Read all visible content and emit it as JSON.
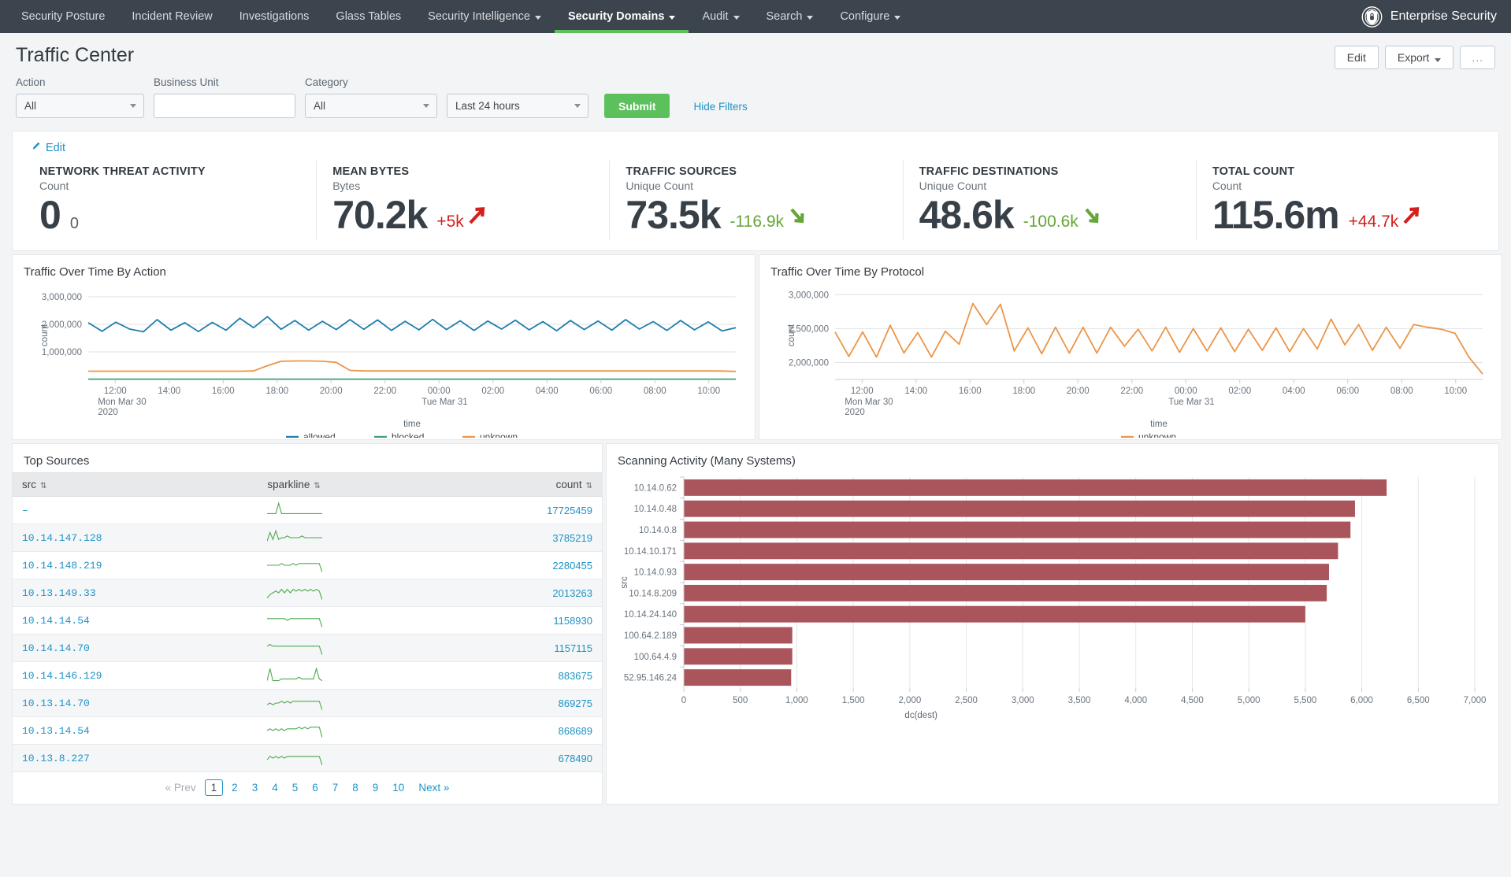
{
  "nav": {
    "items": [
      {
        "label": "Security Posture",
        "dropdown": false,
        "active": false
      },
      {
        "label": "Incident Review",
        "dropdown": false,
        "active": false
      },
      {
        "label": "Investigations",
        "dropdown": false,
        "active": false
      },
      {
        "label": "Glass Tables",
        "dropdown": false,
        "active": false
      },
      {
        "label": "Security Intelligence",
        "dropdown": true,
        "active": false
      },
      {
        "label": "Security Domains",
        "dropdown": true,
        "active": true
      },
      {
        "label": "Audit",
        "dropdown": true,
        "active": false
      },
      {
        "label": "Search",
        "dropdown": true,
        "active": false
      },
      {
        "label": "Configure",
        "dropdown": true,
        "active": false
      }
    ],
    "brand": "Enterprise Security",
    "brand_icon": "shield-lock-icon"
  },
  "header": {
    "title": "Traffic Center",
    "edit_label": "Edit",
    "export_label": "Export",
    "more_label": "..."
  },
  "filters": {
    "action": {
      "label": "Action",
      "value": "All"
    },
    "business_unit": {
      "label": "Business Unit",
      "value": "",
      "placeholder": ""
    },
    "category": {
      "label": "Category",
      "value": "All"
    },
    "time": {
      "value": "Last 24 hours"
    },
    "submit_label": "Submit",
    "hide_filters_label": "Hide Filters"
  },
  "kpi": {
    "edit_label": "Edit",
    "items": [
      {
        "name": "NETWORK THREAT ACTIVITY",
        "sub": "Count",
        "value": "0",
        "delta": "0",
        "direction": "zero"
      },
      {
        "name": "MEAN BYTES",
        "sub": "Bytes",
        "value": "70.2k",
        "delta": "+5k",
        "direction": "up"
      },
      {
        "name": "TRAFFIC SOURCES",
        "sub": "Unique Count",
        "value": "73.5k",
        "delta": "-116.9k",
        "direction": "down"
      },
      {
        "name": "TRAFFIC DESTINATIONS",
        "sub": "Unique Count",
        "value": "48.6k",
        "delta": "-100.6k",
        "direction": "down"
      },
      {
        "name": "TOTAL COUNT",
        "sub": "Count",
        "value": "115.6m",
        "delta": "+44.7k",
        "direction": "up"
      }
    ],
    "colors": {
      "up": "#d41f1f",
      "down": "#65a637",
      "value": "#373f47"
    }
  },
  "chart_data": [
    {
      "id": "traffic-by-action",
      "type": "line",
      "title": "Traffic Over Time By Action",
      "xlabel": "time",
      "ylabel": "count",
      "ylim": [
        0,
        3200000
      ],
      "yticks": [
        1000000,
        2000000,
        3000000
      ],
      "ytick_labels": [
        "1,000,000",
        "2,000,000",
        "3,000,000"
      ],
      "grid": true,
      "legend_position": "bottom",
      "xtick_labels": [
        "12:00",
        "14:00",
        "16:00",
        "18:00",
        "20:00",
        "22:00",
        "00:00",
        "02:00",
        "04:00",
        "06:00",
        "08:00",
        "10:00"
      ],
      "x_day_labels": [
        {
          "at": "12:00",
          "lines": [
            "Mon Mar 30",
            "2020"
          ]
        },
        {
          "at": "00:00",
          "lines": [
            "Tue Mar 31"
          ]
        }
      ],
      "series": [
        {
          "name": "allowed",
          "color": "#1e7eab",
          "values": [
            2060000,
            1750000,
            2080000,
            1830000,
            1730000,
            2170000,
            1790000,
            2060000,
            1740000,
            2070000,
            1790000,
            2220000,
            1880000,
            2280000,
            1820000,
            2140000,
            1790000,
            2110000,
            1810000,
            2170000,
            1820000,
            2160000,
            1780000,
            2110000,
            1800000,
            2180000,
            1810000,
            2130000,
            1780000,
            2120000,
            1830000,
            2150000,
            1800000,
            2100000,
            1770000,
            2140000,
            1810000,
            2120000,
            1790000,
            2170000,
            1830000,
            2100000,
            1780000,
            2140000,
            1800000,
            2090000,
            1760000,
            1880000
          ]
        },
        {
          "name": "blocked",
          "color": "#3f9f73",
          "values": [
            12000,
            12000,
            12000,
            12000,
            12000,
            12000,
            12000,
            12000,
            12000,
            12000,
            12000,
            12000,
            12000,
            12000,
            12000,
            12000,
            12000,
            12000,
            12000,
            12000,
            12000,
            12000,
            12000,
            12000,
            12000,
            12000,
            12000,
            12000,
            12000,
            12000,
            12000,
            12000,
            12000,
            12000,
            12000,
            12000,
            12000,
            12000,
            12000,
            12000,
            12000,
            12000,
            12000,
            12000,
            12000,
            12000,
            12000,
            12000
          ]
        },
        {
          "name": "unknown",
          "color": "#ec9547",
          "values": [
            300000,
            300000,
            300000,
            300000,
            300000,
            300000,
            300000,
            300000,
            300000,
            300000,
            300000,
            300000,
            310000,
            500000,
            660000,
            670000,
            670000,
            660000,
            620000,
            330000,
            310000,
            310000,
            310000,
            310000,
            310000,
            310000,
            310000,
            310000,
            310000,
            310000,
            310000,
            310000,
            310000,
            310000,
            310000,
            310000,
            310000,
            310000,
            310000,
            310000,
            310000,
            310000,
            310000,
            310000,
            310000,
            310000,
            305000,
            290000
          ]
        }
      ]
    },
    {
      "id": "traffic-by-protocol",
      "type": "line",
      "title": "Traffic Over Time By Protocol",
      "xlabel": "time",
      "ylabel": "count",
      "ylim": [
        1750000,
        3050000
      ],
      "yticks": [
        2000000,
        2500000,
        3000000
      ],
      "ytick_labels": [
        "2,000,000",
        "2,500,000",
        "3,000,000"
      ],
      "grid": true,
      "legend_position": "bottom",
      "xtick_labels": [
        "12:00",
        "14:00",
        "16:00",
        "18:00",
        "20:00",
        "22:00",
        "00:00",
        "02:00",
        "04:00",
        "06:00",
        "08:00",
        "10:00"
      ],
      "x_day_labels": [
        {
          "at": "12:00",
          "lines": [
            "Mon Mar 30",
            "2020"
          ]
        },
        {
          "at": "00:00",
          "lines": [
            "Tue Mar 31"
          ]
        }
      ],
      "series": [
        {
          "name": "unknown",
          "color": "#ec9547",
          "values": [
            2450000,
            2090000,
            2450000,
            2080000,
            2550000,
            2140000,
            2440000,
            2080000,
            2460000,
            2270000,
            2870000,
            2560000,
            2860000,
            2170000,
            2510000,
            2130000,
            2520000,
            2140000,
            2520000,
            2140000,
            2520000,
            2240000,
            2490000,
            2170000,
            2520000,
            2150000,
            2500000,
            2170000,
            2510000,
            2160000,
            2490000,
            2180000,
            2510000,
            2160000,
            2500000,
            2200000,
            2640000,
            2260000,
            2560000,
            2180000,
            2520000,
            2210000,
            2560000,
            2520000,
            2490000,
            2430000,
            2080000,
            1830000
          ]
        }
      ]
    },
    {
      "id": "scanning-activity",
      "type": "bar",
      "orientation": "horizontal",
      "title": "Scanning Activity (Many Systems)",
      "xlabel": "dc(dest)",
      "ylabel": "src",
      "xlim": [
        0,
        7000
      ],
      "xticks": [
        0,
        500,
        1000,
        1500,
        2000,
        2500,
        3000,
        3500,
        4000,
        4500,
        5000,
        5500,
        6000,
        6500,
        7000
      ],
      "xtick_labels": [
        "0",
        "500",
        "1,000",
        "1,500",
        "2,000",
        "2,500",
        "3,000",
        "3,500",
        "4,000",
        "4,500",
        "5,000",
        "5,500",
        "6,000",
        "6,500",
        "7,000"
      ],
      "bar_color": "#a9555b",
      "categories": [
        "10.14.0.62",
        "10.14.0.48",
        "10.14.0.8",
        "10.14.10.171",
        "10.14.0.93",
        "10.14.8.209",
        "10.14.24.140",
        "100.64.2.189",
        "100.64.4.9",
        "52.95.146.24"
      ],
      "values": [
        6220,
        5940,
        5900,
        5790,
        5710,
        5690,
        5500,
        960,
        960,
        950
      ]
    }
  ],
  "top_sources": {
    "title": "Top Sources",
    "columns": [
      {
        "label": "src",
        "align": "left"
      },
      {
        "label": "sparkline",
        "align": "left"
      },
      {
        "label": "count",
        "align": "right"
      }
    ],
    "rows": [
      {
        "src": "–",
        "count": "17725459",
        "spark": [
          3,
          3,
          3,
          3,
          9,
          3,
          3,
          3,
          3,
          3,
          3,
          3,
          3,
          3,
          3,
          3,
          3,
          3,
          3,
          3
        ]
      },
      {
        "src": "10.14.147.128",
        "count": "3785219",
        "spark": [
          3,
          8,
          4,
          9,
          4,
          5,
          5,
          6,
          5,
          5,
          5,
          5,
          6,
          5,
          5,
          5,
          5,
          5,
          5,
          5
        ]
      },
      {
        "src": "10.14.148.219",
        "count": "2280455",
        "spark": [
          5,
          5,
          5,
          5,
          5,
          6,
          5,
          5,
          5,
          6,
          5,
          6,
          6,
          6,
          6,
          6,
          6,
          6,
          6,
          1
        ]
      },
      {
        "src": "10.13.149.33",
        "count": "2013263",
        "spark": [
          2,
          4,
          5,
          6,
          5,
          7,
          5,
          7,
          5,
          7,
          6,
          7,
          6,
          7,
          6,
          7,
          6,
          7,
          6,
          1
        ]
      },
      {
        "src": "10.14.14.54",
        "count": "1158930",
        "spark": [
          6,
          6,
          6,
          6,
          6,
          6,
          6,
          5,
          6,
          6,
          6,
          6,
          6,
          6,
          6,
          6,
          6,
          6,
          6,
          1
        ]
      },
      {
        "src": "10.14.14.70",
        "count": "1157115",
        "spark": [
          6,
          7,
          6,
          6,
          6,
          6,
          6,
          6,
          6,
          6,
          6,
          6,
          6,
          6,
          6,
          6,
          6,
          6,
          6,
          1
        ]
      },
      {
        "src": "10.14.146.129",
        "count": "883675",
        "spark": [
          2,
          9,
          2,
          2,
          2,
          3,
          3,
          3,
          3,
          3,
          3,
          4,
          3,
          3,
          3,
          3,
          3,
          9,
          3,
          2
        ]
      },
      {
        "src": "10.13.14.70",
        "count": "869275",
        "spark": [
          4,
          5,
          4,
          5,
          5,
          6,
          5,
          6,
          5,
          6,
          6,
          6,
          6,
          6,
          6,
          6,
          6,
          6,
          6,
          1
        ]
      },
      {
        "src": "10.13.14.54",
        "count": "868689",
        "spark": [
          5,
          6,
          5,
          6,
          5,
          6,
          5,
          6,
          6,
          6,
          6,
          7,
          6,
          7,
          6,
          7,
          7,
          7,
          7,
          1
        ]
      },
      {
        "src": "10.13.8.227",
        "count": "678490",
        "spark": [
          4,
          6,
          5,
          6,
          5,
          6,
          5,
          6,
          6,
          6,
          6,
          6,
          6,
          6,
          6,
          6,
          6,
          6,
          6,
          1
        ]
      }
    ],
    "pager": {
      "prev": "« Prev",
      "pages": [
        "1",
        "2",
        "3",
        "4",
        "5",
        "6",
        "7",
        "8",
        "9",
        "10"
      ],
      "current": "1",
      "next": "Next »"
    },
    "link_color": "#1e93c6",
    "spark_color": "#4fa84f"
  }
}
